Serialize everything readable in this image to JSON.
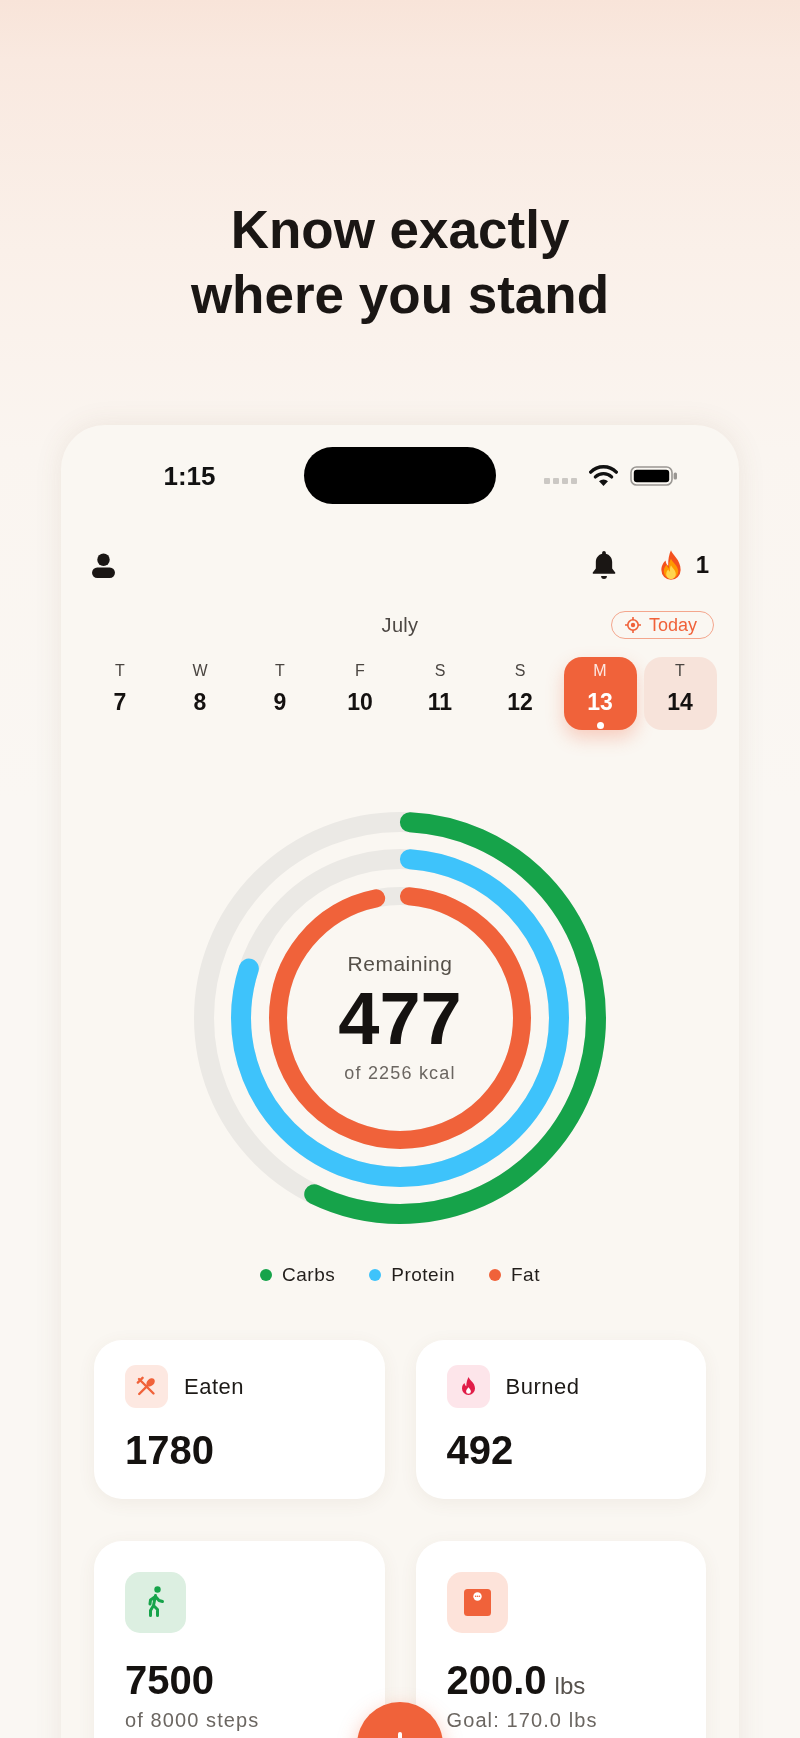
{
  "hero": {
    "title": "Know exactly where you stand"
  },
  "status_bar": {
    "time": "1:15"
  },
  "header": {
    "streak": "1"
  },
  "calendar": {
    "month": "July",
    "today_button": "Today",
    "days": [
      {
        "weekday": "T",
        "date": "7",
        "selected": false,
        "highlighted": false,
        "dot": false
      },
      {
        "weekday": "W",
        "date": "8",
        "selected": false,
        "highlighted": false,
        "dot": false
      },
      {
        "weekday": "T",
        "date": "9",
        "selected": false,
        "highlighted": false,
        "dot": false
      },
      {
        "weekday": "F",
        "date": "10",
        "selected": false,
        "highlighted": false,
        "dot": false
      },
      {
        "weekday": "S",
        "date": "11",
        "selected": false,
        "highlighted": false,
        "dot": false
      },
      {
        "weekday": "S",
        "date": "12",
        "selected": false,
        "highlighted": false,
        "dot": false
      },
      {
        "weekday": "M",
        "date": "13",
        "selected": true,
        "highlighted": false,
        "dot": true
      },
      {
        "weekday": "T",
        "date": "14",
        "selected": false,
        "highlighted": true,
        "dot": false
      }
    ]
  },
  "summary": {
    "label": "Remaining",
    "value": "477",
    "subtitle": "of 2256 kcal",
    "rings": [
      {
        "name": "Carbs",
        "color": "#16a34a",
        "level": 0.58
      },
      {
        "name": "Protein",
        "color": "#3ec3fb",
        "level": 0.81
      },
      {
        "name": "Fat",
        "color": "#f0623a",
        "level": 0.98
      }
    ]
  },
  "cards": [
    {
      "kind": "eaten",
      "label": "Eaten",
      "value": "1780"
    },
    {
      "kind": "burned",
      "label": "Burned",
      "value": "492"
    },
    {
      "kind": "steps",
      "value": "7500",
      "note": "of 8000 steps"
    },
    {
      "kind": "weight",
      "value": "200.0",
      "unit": "lbs",
      "note": "Goal: 170.0 lbs"
    }
  ]
}
